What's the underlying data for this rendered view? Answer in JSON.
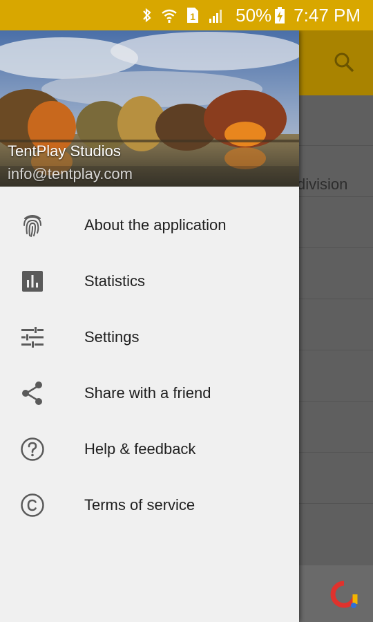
{
  "status_bar": {
    "battery": "50%",
    "time": "7:47 PM",
    "sim_slot": "1"
  },
  "drawer": {
    "header": {
      "name": "TentPlay Studios",
      "email": "info@tentplay.com"
    },
    "items": [
      {
        "label": "About the application",
        "icon": "fingerprint-icon"
      },
      {
        "label": "Statistics",
        "icon": "bar-chart-icon"
      },
      {
        "label": "Settings",
        "icon": "tune-sliders-icon"
      },
      {
        "label": "Share with a friend",
        "icon": "share-icon"
      },
      {
        "label": "Help & feedback",
        "icon": "help-circle-icon"
      },
      {
        "label": "Terms of service",
        "icon": "copyright-icon"
      }
    ]
  },
  "background_app": {
    "visible_text": "division"
  },
  "colors": {
    "accent": "#d8a700",
    "drawer_bg": "#f0f0f0",
    "icon": "#5a5a5a"
  }
}
